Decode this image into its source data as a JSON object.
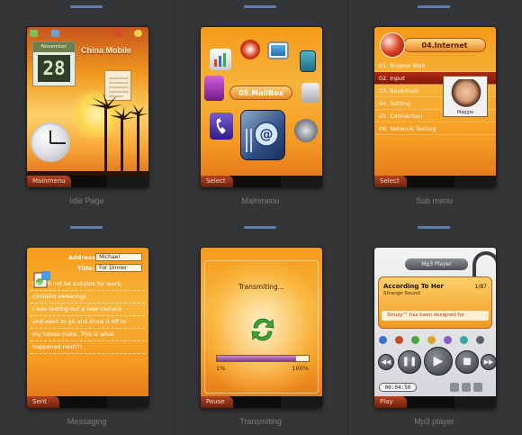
{
  "screens": [
    {
      "caption": "Idle Page",
      "softkey_left": "Mainmenu",
      "calendar_month": "November",
      "calendar_day": "28",
      "carrier": "China Mobile"
    },
    {
      "caption": "Mainmenu",
      "softkey_left": "Select",
      "menu_title": "05.MailBox"
    },
    {
      "caption": "Sub menu",
      "softkey_left": "Select",
      "title": "04.Internet",
      "items": [
        "01. Browse Web",
        "02. Input",
        "03. Bookmark",
        "04. Setting",
        "05. Connection",
        "06. Network Testing"
      ],
      "selected_index": 1,
      "photo_name": "Maggie"
    },
    {
      "caption": "Messaging",
      "softkey_left": "Sent",
      "address_label": "Address:",
      "address_value": "Michael",
      "title_label": "Title:",
      "title_value": "For Dinner",
      "body_lines": [
        "(might not be suitable for work,",
        "contains swearing)",
        "I was testing out a new camera",
        "and went to go and show it off to",
        "my house mate. This is what",
        "happened next!!!"
      ]
    },
    {
      "caption": "Transmiting",
      "softkey_left": "Pause",
      "status": "Transmiting...",
      "progress_start_label": "1%",
      "progress_end_label": "100%",
      "progress": 0.86
    },
    {
      "caption": "Mp3 player",
      "softkey_left": "Play",
      "header": "Mp3 Player",
      "song": "According To Her",
      "artist": "Strange Sound",
      "track": "1/87",
      "lyric": "Struzy™ has been designed for",
      "time": "00:04:50"
    }
  ],
  "colors": {
    "accent": "#f59a1a",
    "softkey": "#8e2a12",
    "background": "#343536"
  }
}
